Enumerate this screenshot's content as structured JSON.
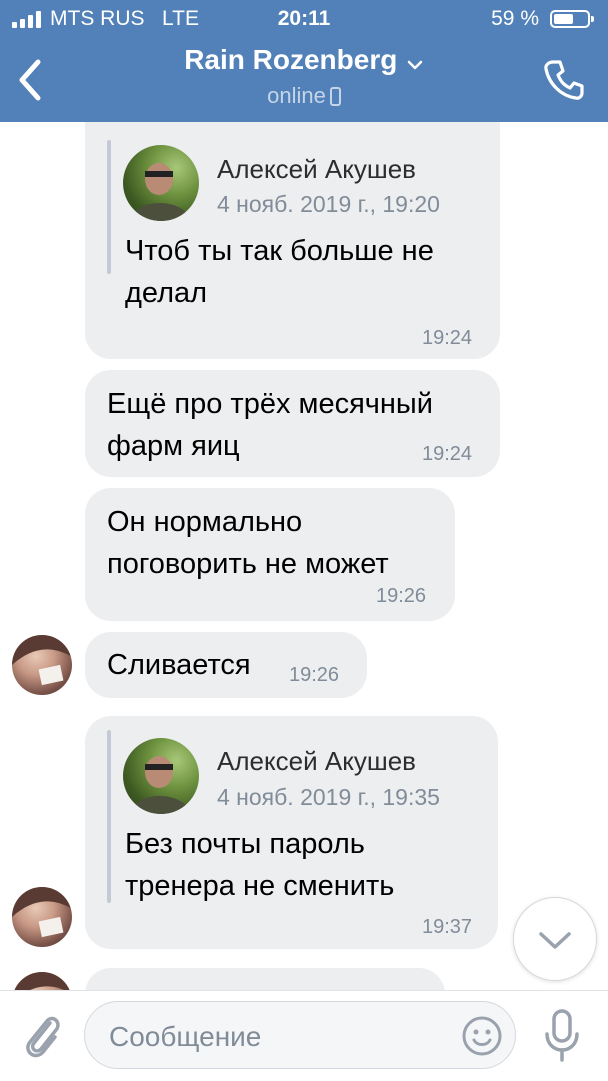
{
  "status_bar": {
    "carrier": "MTS RUS",
    "network": "LTE",
    "time": "20:11",
    "battery": "59 %",
    "battery_level": 0.59
  },
  "header": {
    "title": "Rain Rozenberg",
    "presence": "online",
    "icons": {
      "back": "chevron-left-icon",
      "call": "phone-icon",
      "title_menu": "chevron-down-icon",
      "device": "mobile-icon"
    }
  },
  "messages": [
    {
      "quote": {
        "author": "Алексей Акушев",
        "date": "4 нояб. 2019 г., 19:20"
      },
      "lines": [
        "Чтоб ты так больше не",
        "делал"
      ],
      "time": "19:24"
    },
    {
      "lines": [
        "Ещё про трёх месячный",
        "фарм яиц"
      ],
      "time": "19:24"
    },
    {
      "lines": [
        "Он нормально",
        "поговорить не может"
      ],
      "time": "19:26"
    },
    {
      "lines": [
        "Сливается"
      ],
      "time": "19:26"
    },
    {
      "quote": {
        "author": "Алексей Акушев",
        "date": "4 нояб. 2019 г., 19:35"
      },
      "lines": [
        "Без почты пароль",
        "тренера не сменить"
      ],
      "time": "19:37"
    }
  ],
  "composer": {
    "placeholder": "Сообщение",
    "icons": {
      "attach": "paperclip-icon",
      "emoji": "smile-icon",
      "voice": "microphone-icon"
    }
  },
  "scroll_down": {
    "icon": "chevron-down-icon"
  },
  "colors": {
    "header_bg": "#5181b8",
    "bubble_bg": "#edeef0",
    "secondary_text": "#818c99",
    "icon_gray": "#99a2ad"
  }
}
